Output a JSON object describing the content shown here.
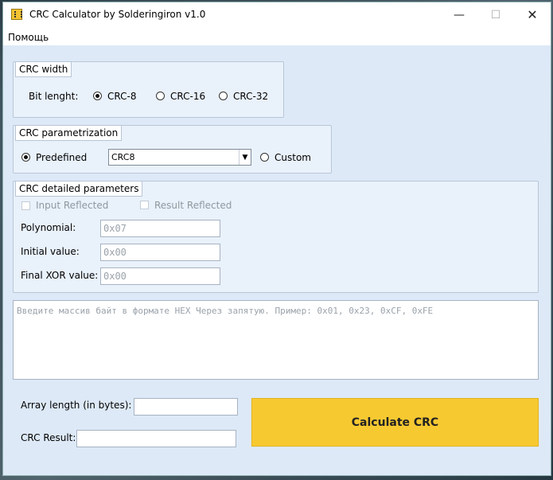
{
  "window": {
    "title": "CRC Calculator by Solderingiron v1.0",
    "controls": {
      "minimize": "—",
      "maximize": "☐",
      "close": "✕"
    }
  },
  "menu": {
    "items": [
      "Помощь"
    ]
  },
  "crc_width": {
    "title": "CRC width",
    "label": "Bit lenght:",
    "options": [
      "CRC-8",
      "CRC-16",
      "CRC-32"
    ],
    "selected": "CRC-8"
  },
  "crc_param": {
    "title": "CRC parametrization",
    "predefined_label": "Predefined",
    "custom_label": "Custom",
    "selected": "Predefined",
    "combo_value": "CRC8"
  },
  "crc_details": {
    "title": "CRC detailed parameters",
    "input_reflected": "Input Reflected",
    "result_reflected": "Result Reflected",
    "polynomial_label": "Polynomial:",
    "polynomial_value": "0x07",
    "initial_label": "Initial value:",
    "initial_value": "0x00",
    "final_xor_label": "Final XOR value:",
    "final_xor_value": "0x00"
  },
  "input": {
    "placeholder": "Введите массив байт в формате HEX Через запятую. Пример: 0x01, 0x23, 0xCF, 0xFE"
  },
  "results": {
    "array_length_label": "Array length (in bytes):",
    "array_length_value": "",
    "crc_result_label": "CRC Result:",
    "crc_result_value": ""
  },
  "calculate_button": "Calculate CRC"
}
